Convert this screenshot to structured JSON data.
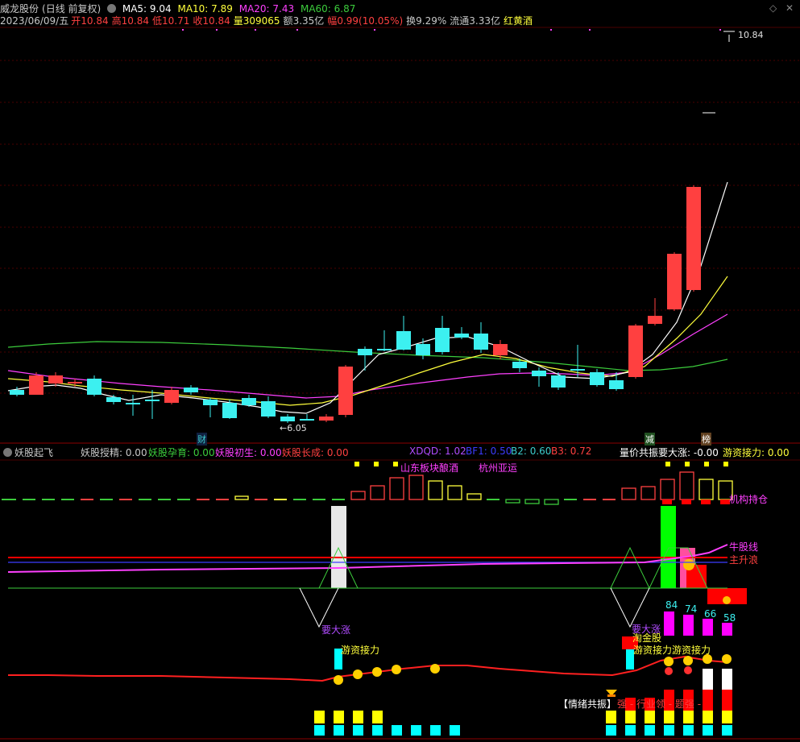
{
  "stock": {
    "name": "威龙股份",
    "period": "(日线 前复权)"
  },
  "ma": [
    {
      "label": "MA5: 9.04",
      "color": "#ffffff"
    },
    {
      "label": "MA10: 7.89",
      "color": "#ffff3c"
    },
    {
      "label": "MA20: 7.43",
      "color": "#ff40ff"
    },
    {
      "label": "MA60: 6.87",
      "color": "#3ccc3c"
    }
  ],
  "quote": {
    "date": "2023/06/09/五",
    "open_k": "开",
    "open_v": "10.84",
    "high_k": "高",
    "high_v": "10.84",
    "low_k": "低",
    "low_v": "10.71",
    "close_k": "收",
    "close_v": "10.84",
    "vol_k": "量",
    "vol_v": "309065",
    "amt_k": "额",
    "amt_v": "3.35亿",
    "chg_k": "幅",
    "chg_v": "0.99(10.05%)",
    "turn": "换9.29%",
    "float": "流通3.33亿",
    "concept": "红黄酒"
  },
  "price_labels": {
    "high": "10.84",
    "low": "6.05"
  },
  "markers": {
    "cai": "财",
    "jian": "减",
    "bang": "榜"
  },
  "indicator": {
    "name": "妖股起飞",
    "items": [
      {
        "text": "妖股授精: 0.00",
        "color": "#c8c8c8"
      },
      {
        "text": "妖股孕育: 0.00",
        "color": "#3ccc3c"
      },
      {
        "text": "妖股初生: 0.00",
        "color": "#ff40ff"
      },
      {
        "text": "妖股长成: 0.00",
        "color": "#ff4040"
      }
    ],
    "xdqd": [
      {
        "text": "XDQD: 1.02",
        "color": "#b04cff"
      },
      {
        "text": "BF1: 0.50",
        "color": "#3c3cff"
      },
      {
        "text": "B2: 0.60",
        "color": "#3ccccc"
      },
      {
        "text": "B3: 0.72",
        "color": "#ff4040"
      }
    ],
    "right": [
      {
        "text": "量价共振要大涨: -0.00",
        "color": "#ffffff"
      },
      {
        "text": "游资接力: 0.00",
        "color": "#ffff3c"
      }
    ]
  },
  "annotations": {
    "shandong": "山东板块酿酒",
    "hangzhou": "杭州亚运",
    "jigou": "机构持仓",
    "niugu": "牛股线",
    "zhusheng": "主升浪",
    "yaodazhang1": "要大涨",
    "yaodazhang2": "要大涨",
    "youzi1": "游资接力",
    "youzi2": "游资接力",
    "youzi3": "游资接力",
    "taojin": "淘金股",
    "qingxu": "【情绪共振】",
    "qingxu_tail": "强 - 行业领 - 题强 -",
    "bars": [
      "84",
      "74",
      "66",
      "58"
    ]
  },
  "colors": {
    "up": "#ff4040",
    "down": "#3cf0f0",
    "bg": "#000000"
  },
  "icons": [
    "dropdown-icon",
    "diamond-icon",
    "close-icon",
    "smiley-icon",
    "lamp-icon"
  ]
}
